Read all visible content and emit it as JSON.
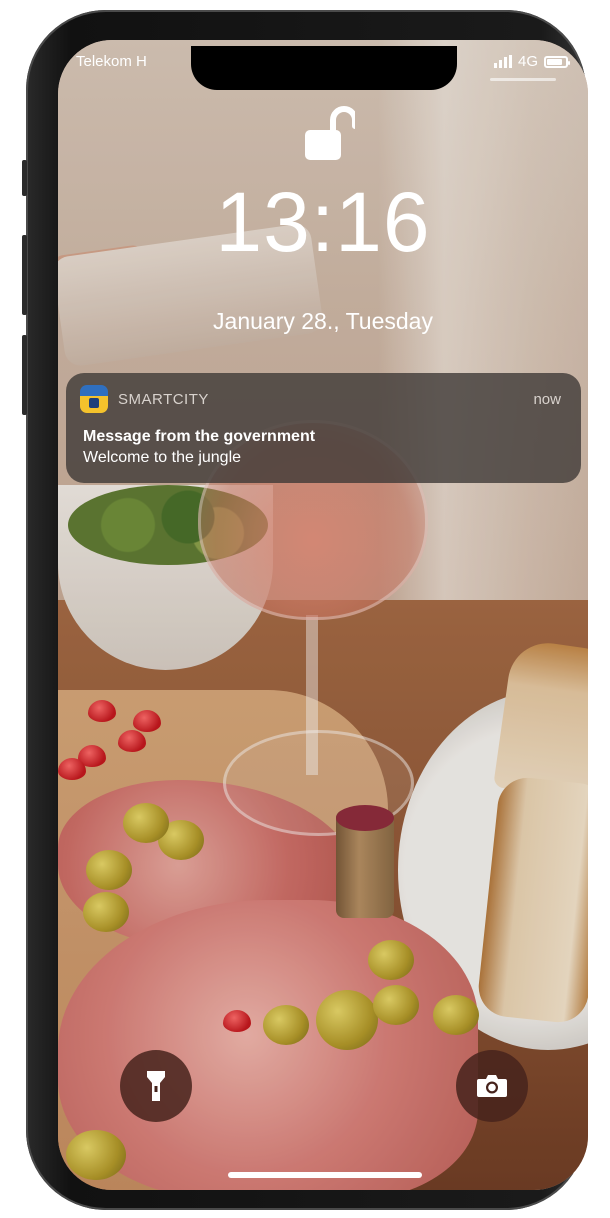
{
  "status_bar": {
    "carrier": "Telekom H",
    "network": "4G",
    "signal_icon": "signal-bars-icon",
    "battery_icon": "battery-icon"
  },
  "lock_screen": {
    "lock_icon": "unlock-icon",
    "time": "13:16",
    "date": "January 28., Tuesday"
  },
  "notification": {
    "app_name": "SMARTCITY",
    "time": "now",
    "title": "Message from the government",
    "body": "Welcome to the jungle"
  },
  "controls": {
    "flashlight_icon": "flashlight-icon",
    "camera_icon": "camera-icon"
  },
  "colors": {
    "notification_bg": "#3e3a37",
    "control_button_bg": "#46231c",
    "text": "#ffffff"
  }
}
